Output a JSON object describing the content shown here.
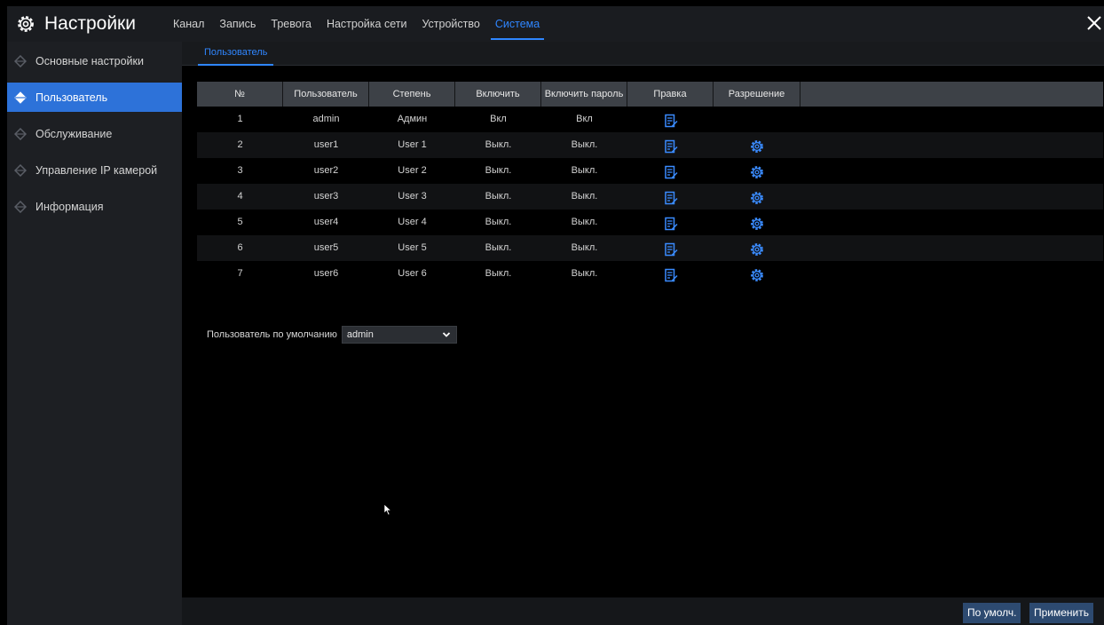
{
  "header": {
    "title": "Настройки",
    "tabs": [
      {
        "label": "Канал"
      },
      {
        "label": "Запись"
      },
      {
        "label": "Тревога"
      },
      {
        "label": "Настройка сети"
      },
      {
        "label": "Устройство"
      },
      {
        "label": "Система",
        "active": true
      }
    ],
    "icon": "gear-icon",
    "close_icon": "close-icon"
  },
  "sidebar": {
    "items": [
      {
        "label": "Основные настройки"
      },
      {
        "label": "Пользователь",
        "active": true
      },
      {
        "label": "Обслуживание"
      },
      {
        "label": "Управление IP камерой"
      },
      {
        "label": "Информация"
      }
    ]
  },
  "subtab": {
    "label": "Пользователь"
  },
  "table": {
    "columns": [
      "№",
      "Пользователь",
      "Степень",
      "Включить",
      "Включить пароль",
      "Правка",
      "Разрешение"
    ],
    "rows": [
      {
        "no": "1",
        "user": "admin",
        "level": "Админ",
        "enable": "Вкл",
        "password": "Вкл",
        "has_permission": false
      },
      {
        "no": "2",
        "user": "user1",
        "level": "User 1",
        "enable": "Выкл.",
        "password": "Выкл.",
        "has_permission": true
      },
      {
        "no": "3",
        "user": "user2",
        "level": "User 2",
        "enable": "Выкл.",
        "password": "Выкл.",
        "has_permission": true
      },
      {
        "no": "4",
        "user": "user3",
        "level": "User 3",
        "enable": "Выкл.",
        "password": "Выкл.",
        "has_permission": true
      },
      {
        "no": "5",
        "user": "user4",
        "level": "User 4",
        "enable": "Выкл.",
        "password": "Выкл.",
        "has_permission": true
      },
      {
        "no": "6",
        "user": "user5",
        "level": "User 5",
        "enable": "Выкл.",
        "password": "Выкл.",
        "has_permission": true
      },
      {
        "no": "7",
        "user": "user6",
        "level": "User 6",
        "enable": "Выкл.",
        "password": "Выкл.",
        "has_permission": true
      }
    ]
  },
  "default_user": {
    "label": "Пользователь по умолчанию",
    "value": "admin"
  },
  "footer": {
    "default_label": "По умолч.",
    "apply_label": "Применить"
  },
  "colors": {
    "accent": "#2f86ff",
    "active_bg": "#2d72d9",
    "button_bg": "#2d4a70"
  }
}
